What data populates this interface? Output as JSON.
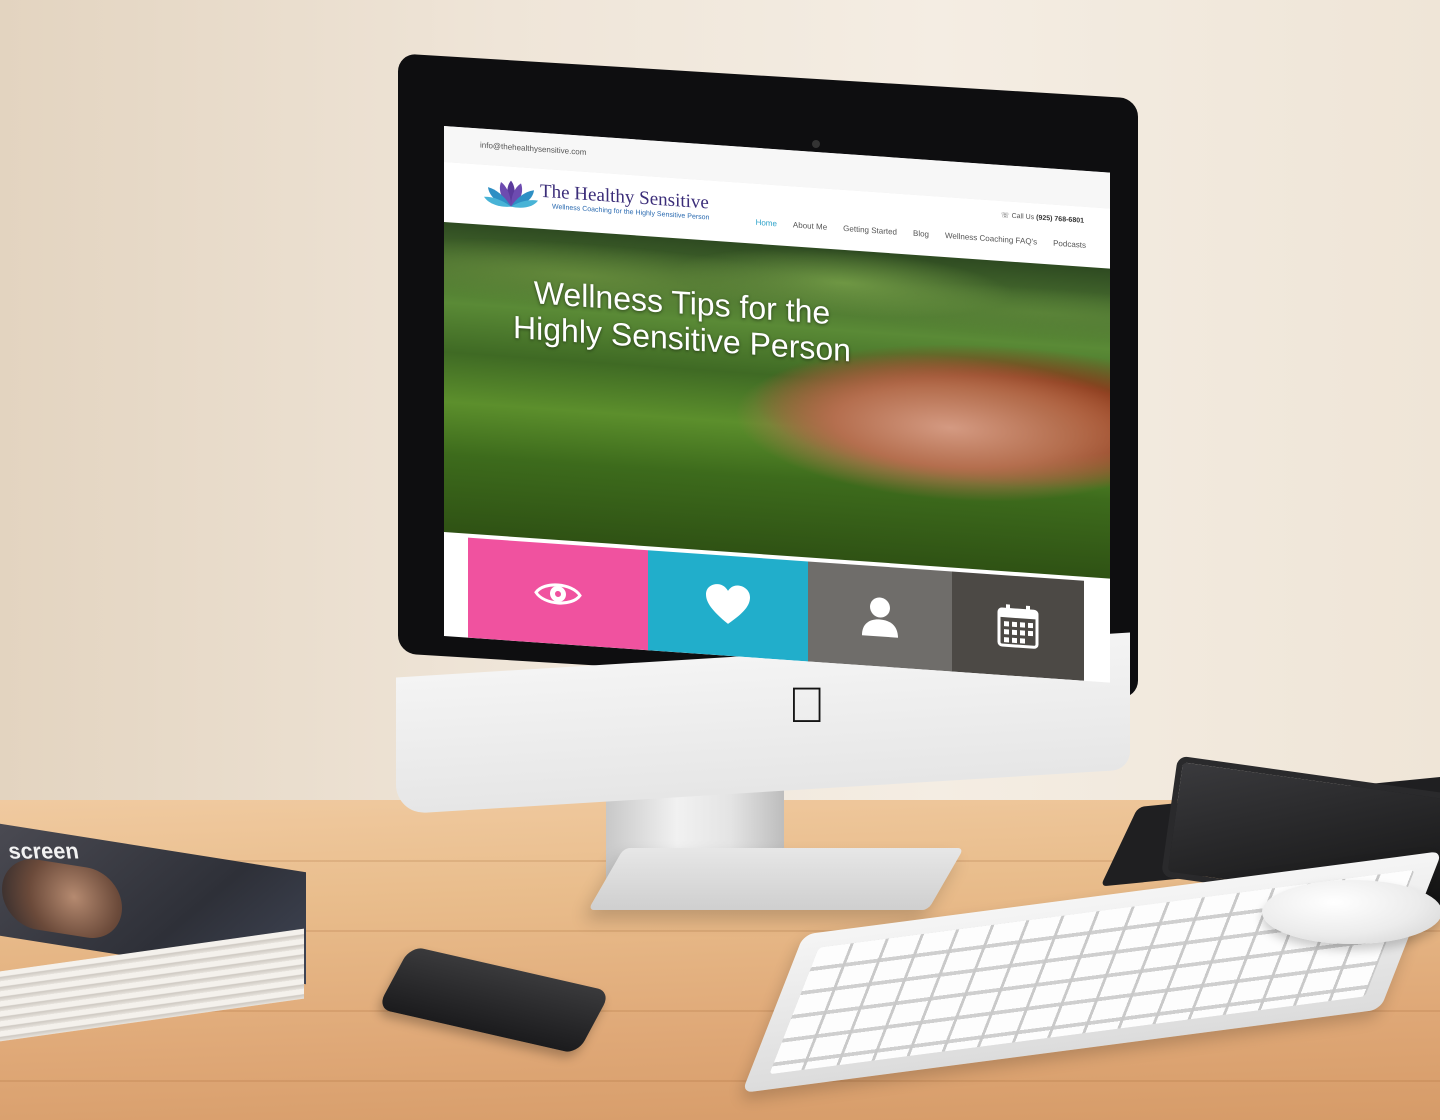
{
  "site": {
    "email": "info@thehealthysensitive.com",
    "brand": "The Healthy Sensitive",
    "tagline": "Wellness Coaching for the Highly Sensitive Person",
    "call_label": "Call Us",
    "phone": "(925) 768-6801"
  },
  "nav": {
    "items": [
      "Home",
      "About Me",
      "Getting Started",
      "Blog",
      "Wellness Coaching FAQ's",
      "Podcasts"
    ],
    "active": "Home"
  },
  "hero": {
    "title": "Wellness Tips for the Highly Sensitive Person"
  },
  "tiles": [
    {
      "icon": "eye-icon",
      "color": "#f0529f"
    },
    {
      "icon": "heart-icon",
      "color": "#21aecb"
    },
    {
      "icon": "user-icon",
      "color": "#6f6d6a"
    },
    {
      "icon": "calendar-icon",
      "color": "#4c4945"
    }
  ],
  "magazine": {
    "cover_title": "screen"
  }
}
